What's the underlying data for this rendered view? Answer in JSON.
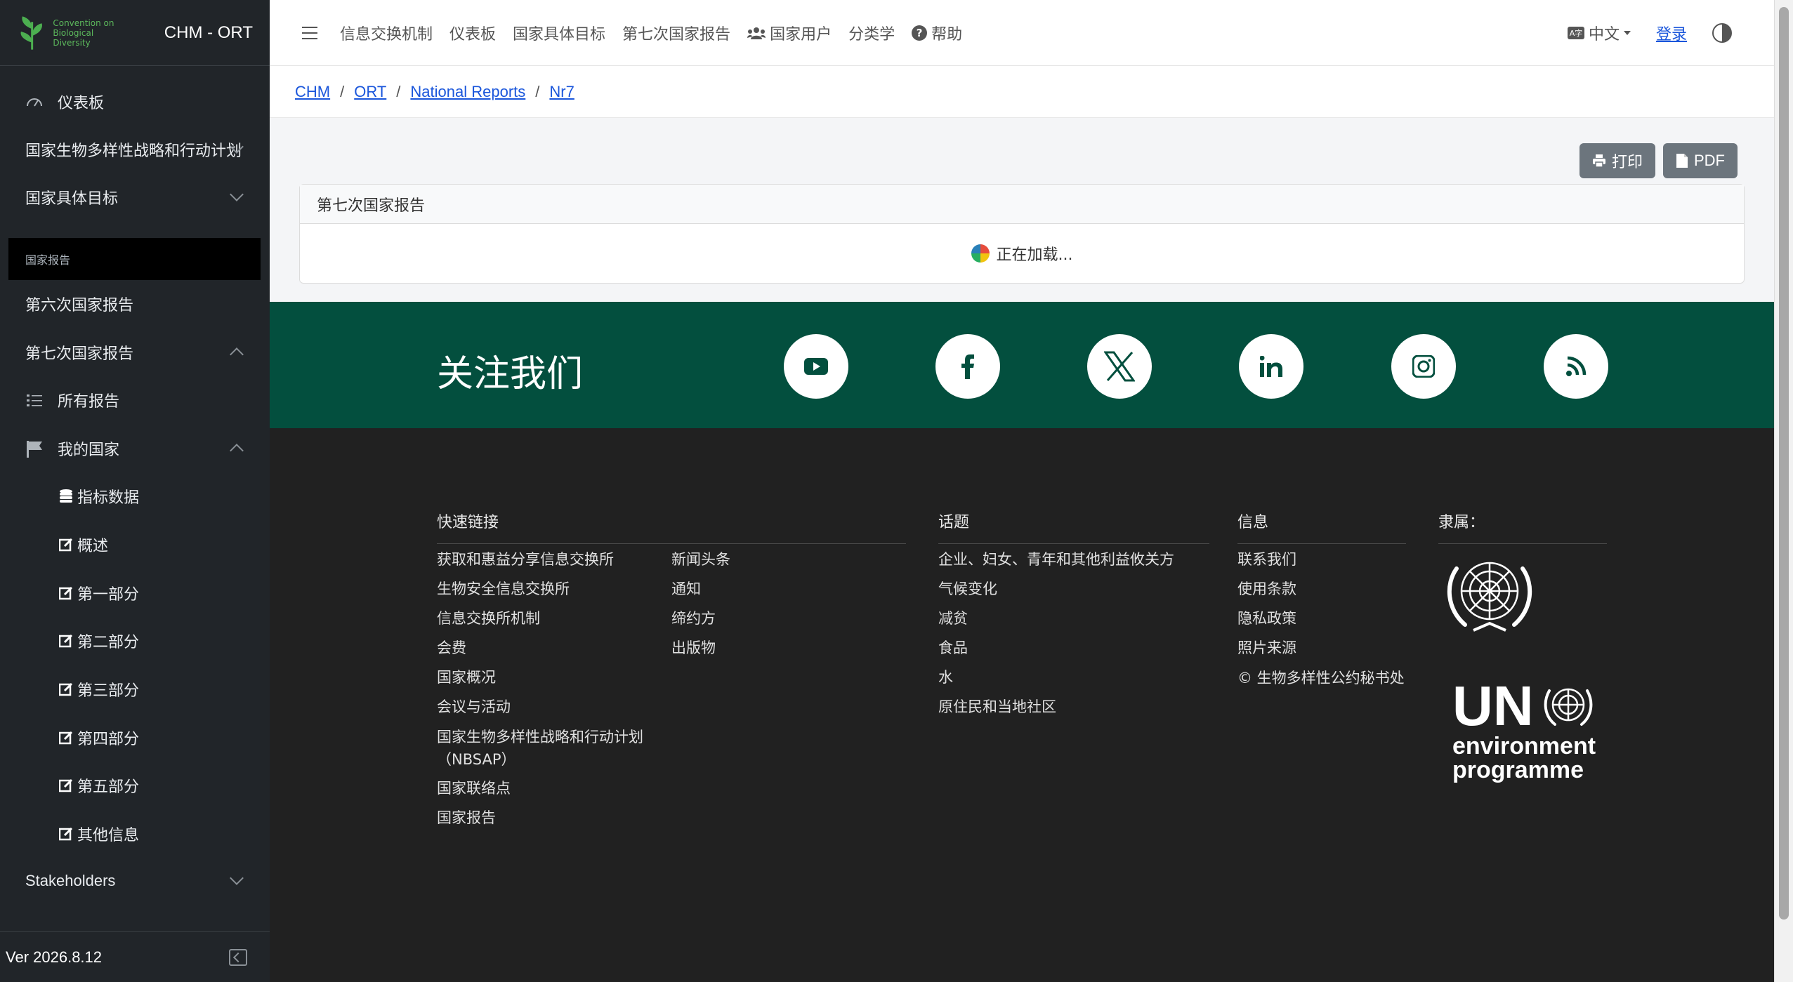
{
  "sidebar": {
    "brand_title": "CHM - ORT",
    "logo_text": "Convention on Biological Diversity",
    "items": [
      {
        "label": "仪表板",
        "icon": "dashboard-icon"
      },
      {
        "label": "国家生物多样性战略和行动计划"
      },
      {
        "label": "国家具体目标"
      },
      {
        "label": "国家报告"
      },
      {
        "label": "第六次国家报告"
      },
      {
        "label": "第七次国家报告"
      },
      {
        "label": "所有报告",
        "icon": "list-icon"
      },
      {
        "label": "我的国家",
        "icon": "flag-icon"
      },
      {
        "label": "指标数据",
        "icon": "database-icon"
      },
      {
        "label": "概述",
        "icon": "edit-icon"
      },
      {
        "label": "第一部分",
        "icon": "edit-icon"
      },
      {
        "label": "第二部分",
        "icon": "edit-icon"
      },
      {
        "label": "第三部分",
        "icon": "edit-icon"
      },
      {
        "label": "第四部分",
        "icon": "edit-icon"
      },
      {
        "label": "第五部分",
        "icon": "edit-icon"
      },
      {
        "label": "其他信息",
        "icon": "edit-icon"
      },
      {
        "label": "Stakeholders"
      }
    ],
    "version": "Ver 2026.8.12"
  },
  "topbar": {
    "nav": [
      "信息交换机制",
      "仪表板",
      "国家具体目标",
      "第七次国家报告",
      "国家用户",
      "分类学",
      "帮助"
    ],
    "language": "中文",
    "login": "登录"
  },
  "breadcrumb": [
    "CHM",
    "ORT",
    "National Reports",
    "Nr7"
  ],
  "toolbar": {
    "print": "打印",
    "pdf": "PDF"
  },
  "card": {
    "title": "第七次国家报告",
    "loading": "正在加载..."
  },
  "follow": {
    "title": "关注我们",
    "icons": [
      "youtube-icon",
      "facebook-icon",
      "x-icon",
      "linkedin-icon",
      "instagram-icon",
      "rss-icon"
    ]
  },
  "footer": {
    "quick_links_title": "快速链接",
    "quick_links_col1": [
      "获取和惠益分享信息交换所",
      "生物安全信息交换所",
      "信息交换所机制",
      "会费",
      "国家概况",
      "会议与活动",
      "国家生物多样性战略和行动计划（NBSAP）",
      "国家联络点",
      "国家报告"
    ],
    "quick_links_col2": [
      "新闻头条",
      "通知",
      "缔约方",
      "出版物"
    ],
    "topics_title": "话题",
    "topics": [
      "企业、妇女、青年和其他利益攸关方",
      "气候变化",
      "减贫",
      "食品",
      "水",
      "原住民和当地社区"
    ],
    "info_title": "信息",
    "info": [
      "联系我们",
      "使用条款",
      "隐私政策",
      "照片来源",
      "© 生物多样性公约秘书处"
    ],
    "affiliation_title": "隶属：",
    "unep_un": "UN",
    "unep_line1": "environment",
    "unep_line2": "programme"
  }
}
